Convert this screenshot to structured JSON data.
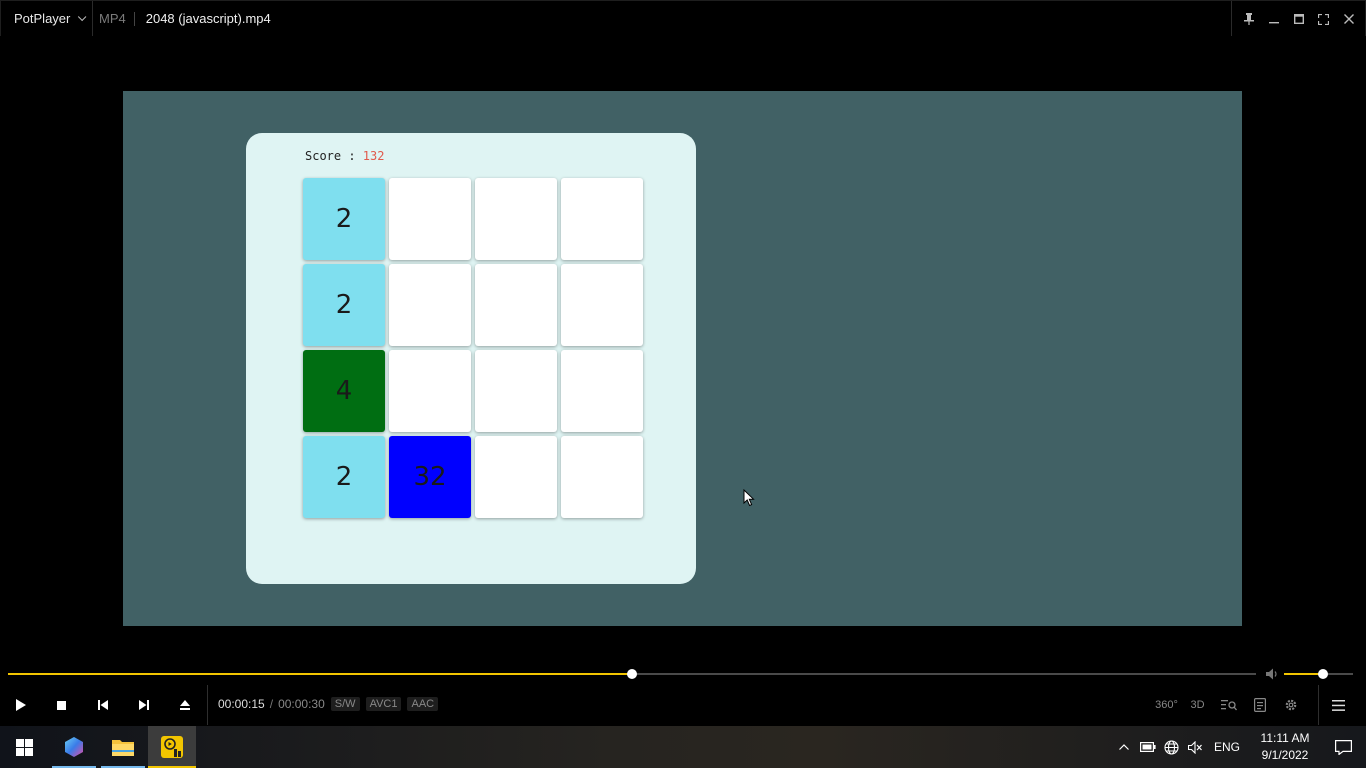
{
  "window": {
    "app_name": "PotPlayer",
    "format": "MP4",
    "file_title": "2048 (javascript).mp4"
  },
  "game": {
    "score_label": "Score : ",
    "score_value": "132",
    "tiles": [
      {
        "value": "2",
        "color": "#7fdfef"
      },
      {
        "value": "",
        "color": "#ffffff"
      },
      {
        "value": "",
        "color": "#ffffff"
      },
      {
        "value": "",
        "color": "#ffffff"
      },
      {
        "value": "2",
        "color": "#7fdfef"
      },
      {
        "value": "",
        "color": "#ffffff"
      },
      {
        "value": "",
        "color": "#ffffff"
      },
      {
        "value": "",
        "color": "#ffffff"
      },
      {
        "value": "4",
        "color": "#006e12"
      },
      {
        "value": "",
        "color": "#ffffff"
      },
      {
        "value": "",
        "color": "#ffffff"
      },
      {
        "value": "",
        "color": "#ffffff"
      },
      {
        "value": "2",
        "color": "#7fdfef"
      },
      {
        "value": "32",
        "color": "#0000ff"
      },
      {
        "value": "",
        "color": "#ffffff"
      },
      {
        "value": "",
        "color": "#ffffff"
      }
    ]
  },
  "playback": {
    "current_time": "00:00:15",
    "separator": "/",
    "duration": "00:00:30",
    "progress": 0.5,
    "volume": 0.57,
    "badges": [
      "S/W",
      "AVC1",
      "AAC"
    ],
    "right_buttons": [
      "360°",
      "3D"
    ]
  },
  "taskbar": {
    "language": "ENG",
    "time": "11:11 AM",
    "date": "9/1/2022"
  },
  "colors": {
    "accent": "#f2c500",
    "frame_bg": "#416165",
    "card_bg": "#dff4f3",
    "score_value": "#e05a4c"
  }
}
